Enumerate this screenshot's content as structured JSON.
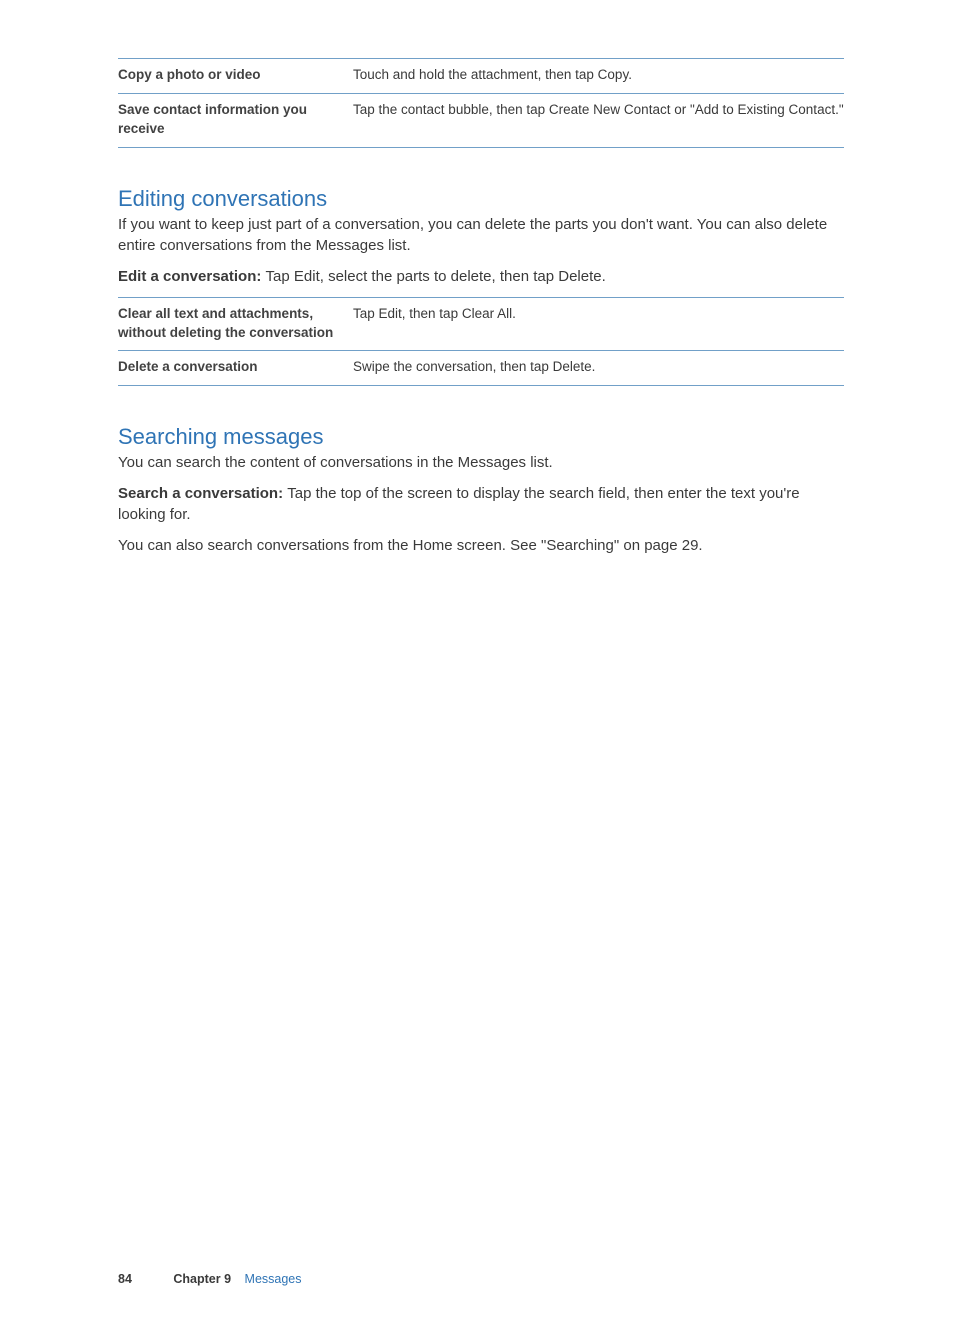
{
  "table1": {
    "rows": [
      {
        "left": "Copy a photo or video",
        "right": "Touch and hold the attachment, then tap Copy."
      },
      {
        "left": "Save contact information you receive",
        "right": "Tap the contact bubble, then tap Create New Contact or \"Add to Existing Contact.\""
      }
    ]
  },
  "section1": {
    "heading": "Editing conversations",
    "body": "If you want to keep just part of a conversation, you can delete the parts you don't want. You can also delete entire conversations from the Messages list.",
    "instruction_lead": "Edit a conversation:  ",
    "instruction_rest": "Tap Edit, select the parts to delete, then tap Delete."
  },
  "table2": {
    "rows": [
      {
        "left": "Clear all text and attachments, without deleting the conversation",
        "right": "Tap Edit, then tap Clear All."
      },
      {
        "left": "Delete a conversation",
        "right": "Swipe the conversation, then tap Delete."
      }
    ]
  },
  "section2": {
    "heading": "Searching messages",
    "body": "You can search the content of conversations in the Messages list.",
    "instruction_lead": "Search a conversation:  ",
    "instruction_rest": "Tap the top of the screen to display the search field, then enter the text you're looking for.",
    "extra": "You can also search conversations from the Home screen. See \"Searching\" on page 29."
  },
  "footer": {
    "pagenum": "84",
    "chapter_label": "Chapter 9",
    "chapter_name": "Messages"
  }
}
